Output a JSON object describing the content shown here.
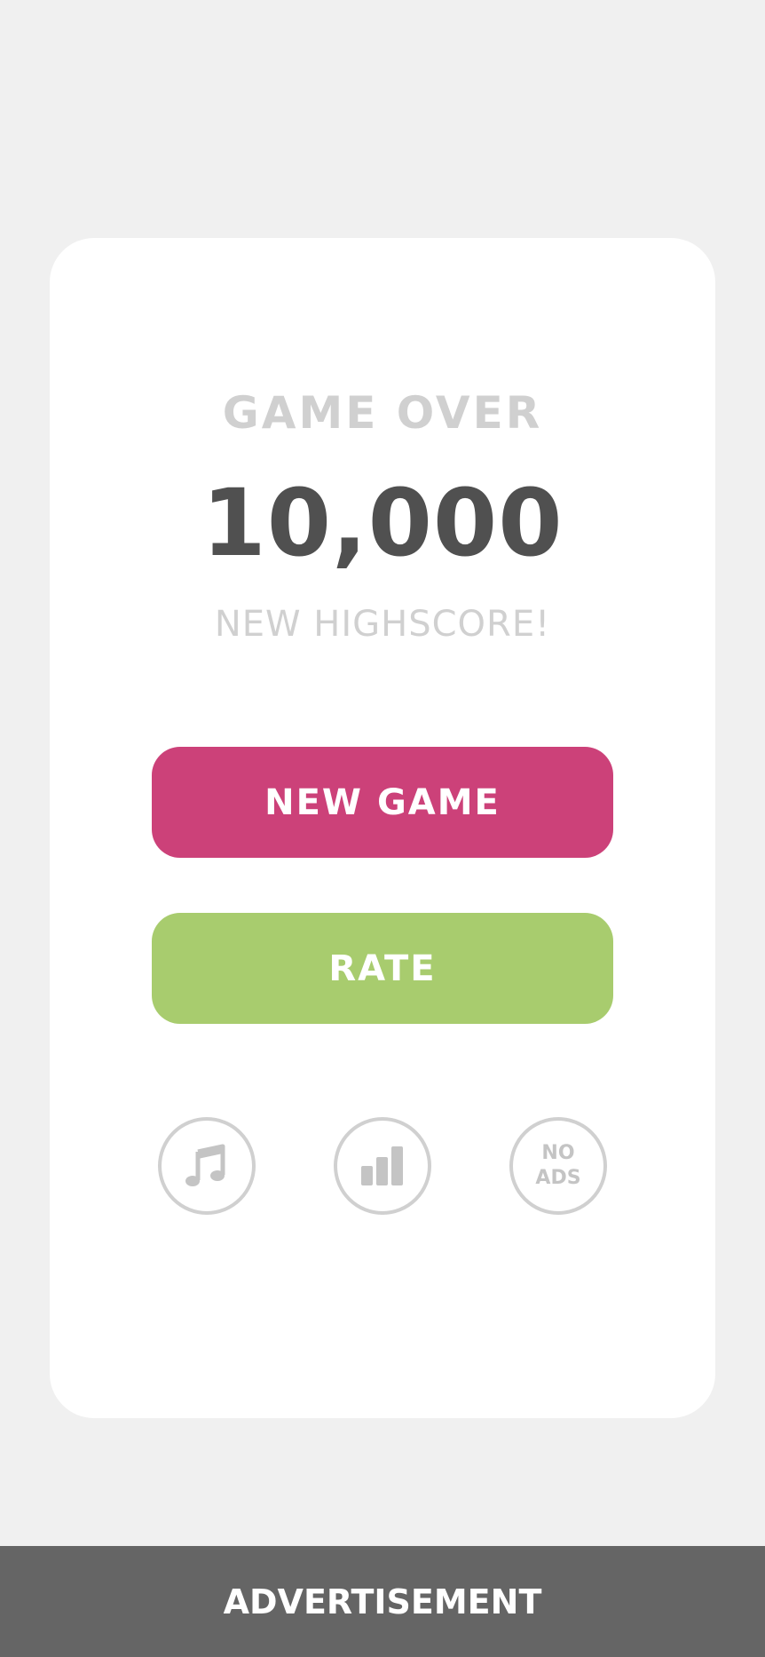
{
  "game_over": {
    "title": "GAME OVER",
    "score": "10,000",
    "message": "NEW HIGHSCORE!"
  },
  "buttons": {
    "new_game_label": "NEW GAME",
    "rate_label": "RATE"
  },
  "icons": {
    "music": "music-note-icon",
    "leaderboard": "bar-chart-icon",
    "no_ads_line1": "NO",
    "no_ads_line2": "ADS"
  },
  "ad": {
    "label": "ADVERTISEMENT"
  },
  "colors": {
    "background": "#f0f0f0",
    "card": "#ffffff",
    "new_game": "#cc4179",
    "rate": "#a8cc6e",
    "score_text": "#505050",
    "muted_text": "#d0d0d0",
    "ad_bar": "#656565"
  }
}
